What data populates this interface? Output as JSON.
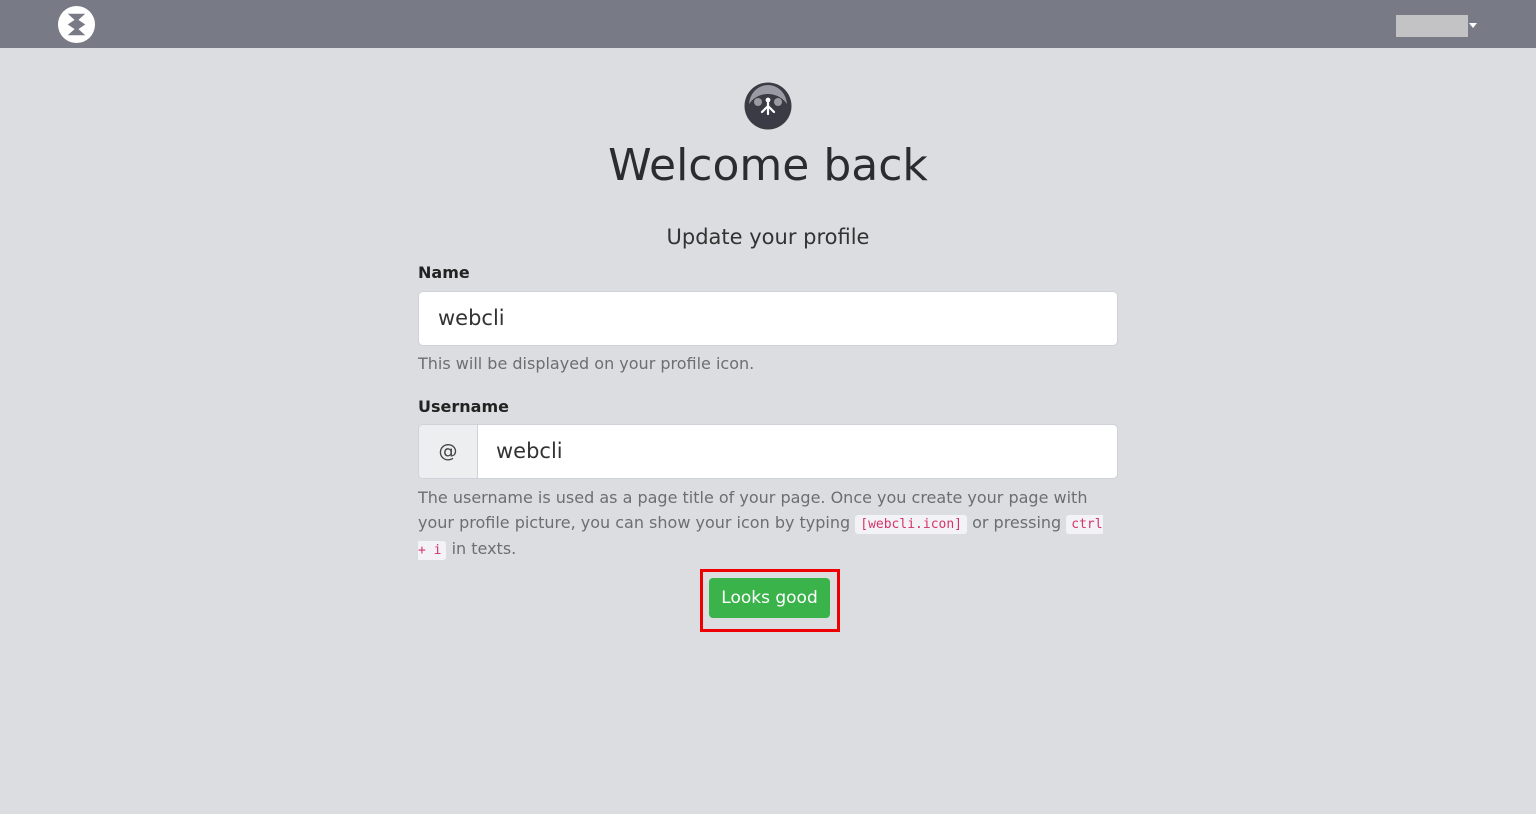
{
  "header": {
    "logo_icon": "scrapbox-logo-icon",
    "user_menu_icon": "chevron-down-icon"
  },
  "profile": {
    "avatar_icon": "default-profile-avatar-icon",
    "title": "Welcome back",
    "subtitle": "Update your profile"
  },
  "form": {
    "name_label": "Name",
    "name_value": "webcli",
    "name_help": "This will be displayed on your profile icon.",
    "username_label": "Username",
    "username_prefix": "@",
    "username_value": "webcli",
    "username_help_part1": "The username is used as a page title of your page. Once you create your page with your profile picture, you can show your icon by typing ",
    "username_help_code1": "[webcli.icon]",
    "username_help_part2": " or pressing ",
    "username_help_code2": "ctrl + i",
    "username_help_part3": " in texts.",
    "submit_label": "Looks good"
  },
  "colors": {
    "navbar": "#787a85",
    "background": "#dcdde0",
    "primary_button": "#3ab34a",
    "highlight": "#ee0000",
    "code_text": "#d6336c"
  }
}
